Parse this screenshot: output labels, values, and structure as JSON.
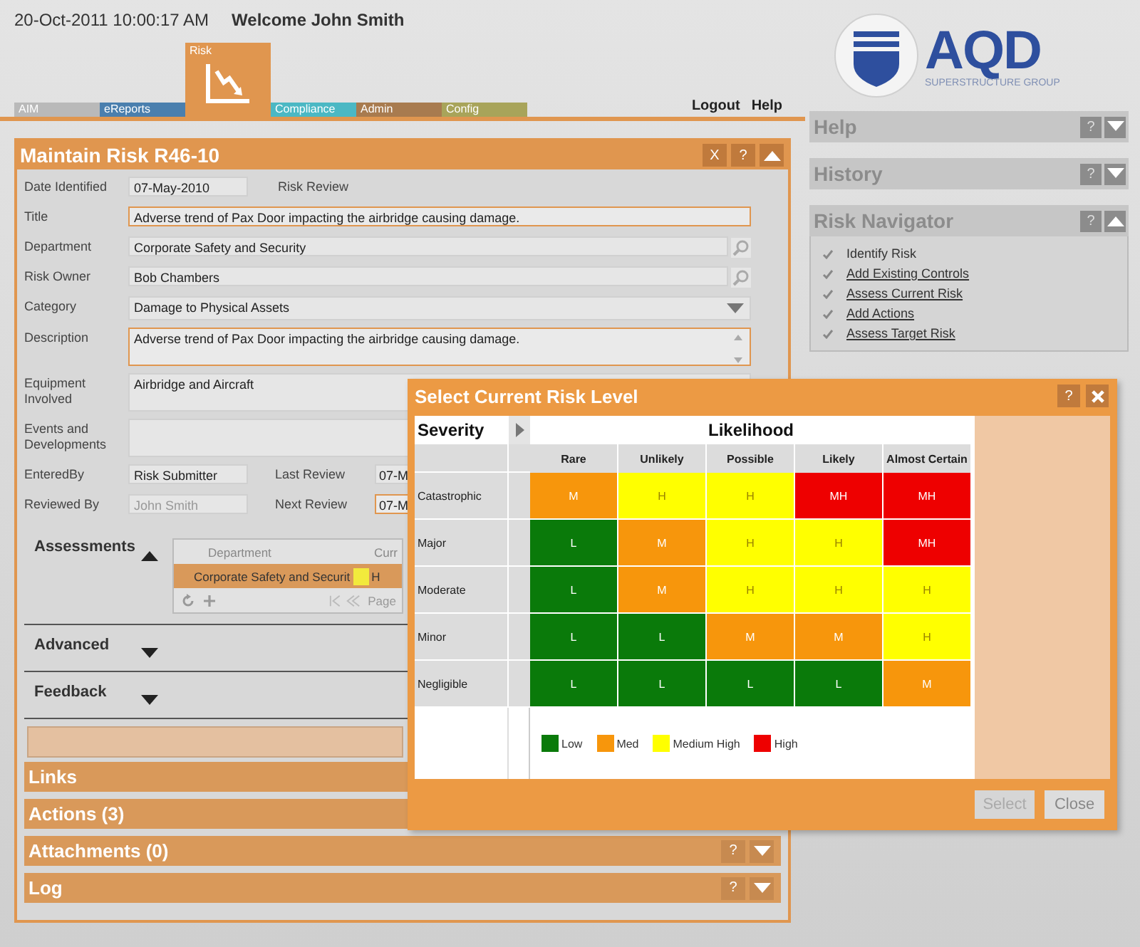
{
  "header": {
    "datetime": "20-Oct-2011 10:00:17 AM",
    "welcome": "Welcome John Smith",
    "links": [
      "Logout",
      "Help"
    ]
  },
  "nav_tabs": [
    {
      "label": "AIM",
      "selected": false,
      "color": "#b9b9b9"
    },
    {
      "label": "eReports",
      "selected": false,
      "color": "#4a7fae"
    },
    {
      "label": "Risk",
      "selected": true,
      "color": "#e0964f"
    },
    {
      "label": "Compliance",
      "selected": false,
      "color": "#4bb8c4"
    },
    {
      "label": "Admin",
      "selected": false,
      "color": "#a87b4f"
    },
    {
      "label": "Config",
      "selected": false,
      "color": "#a8a45a"
    }
  ],
  "logo": {
    "name": "AQD",
    "tagline": "SUPERSTRUCTURE GROUP"
  },
  "main_panel": {
    "title": "Maintain Risk R46-10",
    "close_button": "X",
    "help_button": "?",
    "expanded": true,
    "fields": [
      {
        "kind": "note",
        "label": "Date Identified",
        "value": "07-May-2010",
        "note": "Risk Review"
      },
      {
        "kind": "text",
        "label": "Title",
        "value": "Adverse trend of Pax Door impacting the airbridge causing damage.",
        "highlighted": true
      },
      {
        "kind": "lookup",
        "label": "Department",
        "value": "Corporate Safety and Security",
        "highlighted": false
      },
      {
        "kind": "lookup",
        "label": "Risk Owner",
        "value": "Bob Chambers",
        "highlighted": false
      },
      {
        "kind": "dropdown",
        "label": "Category",
        "value": "Damage to Physical Assets",
        "highlighted": false
      },
      {
        "kind": "textarea",
        "label": "Description",
        "value": "Adverse trend of Pax Door impacting the airbridge causing damage.",
        "highlighted": true
      },
      {
        "kind": "area",
        "label": "Equipment Involved",
        "value": "Airbridge and Aircraft",
        "highlighted": false
      },
      {
        "kind": "area",
        "label": "Events and Developments",
        "highlighted": false
      },
      {
        "kind": "pair",
        "label": "EnteredBy",
        "value": "Risk Submitter",
        "disabled": false,
        "second_label": "Last Review",
        "second_value": "07-M",
        "second_highlighted": false
      },
      {
        "kind": "pair",
        "label": "Reviewed By",
        "value": "John Smith",
        "disabled": true,
        "second_label": "Next Review",
        "second_value": "07-M",
        "second_highlighted": true
      }
    ],
    "assessments": {
      "label": "Assessments",
      "expanded": true,
      "columns": [
        "Department",
        "Curr"
      ],
      "rows": [
        {
          "department": "Corporate Safety and Securit",
          "color": "#f2ea3c",
          "level": "H",
          "selected": true
        }
      ],
      "pager": "Page"
    },
    "subsections": [
      {
        "label": "Advanced",
        "expanded": false
      },
      {
        "label": "Feedback",
        "expanded": false
      }
    ],
    "sections": [
      {
        "label": "Links"
      },
      {
        "label": "Actions (3)"
      },
      {
        "label": "Attachments (0)",
        "expanded": false,
        "help_button": "?"
      },
      {
        "label": "Log",
        "expanded": false,
        "help_button": "?"
      }
    ]
  },
  "sidebar": [
    {
      "title": "Help",
      "help_button": "?",
      "expanded": false
    },
    {
      "title": "History",
      "help_button": "?",
      "expanded": false
    },
    {
      "title": "Risk Navigator",
      "help_button": "?",
      "expanded": true,
      "items": [
        {
          "label": "Identify Risk",
          "link": false
        },
        {
          "label": "Add Existing Controls",
          "link": true
        },
        {
          "label": "Assess Current Risk",
          "link": true
        },
        {
          "label": "Add Actions",
          "link": true
        },
        {
          "label": "Assess Target Risk",
          "link": true
        }
      ]
    }
  ],
  "dialog": {
    "title": "Select Current Risk Level",
    "help_button": "?",
    "severity_header": "Severity",
    "likelihood_header": "Likelihood",
    "columns": [
      "Rare",
      "Unlikely",
      "Possible",
      "Likely",
      "Almost Certain"
    ],
    "rows": [
      {
        "severity": "Catastrophic",
        "cells": [
          {
            "text": "M",
            "color": "#f7960c"
          },
          {
            "text": "H",
            "color": "#ffff00"
          },
          {
            "text": "H",
            "color": "#ffff00"
          },
          {
            "text": "MH",
            "color": "#ee0000"
          },
          {
            "text": "MH",
            "color": "#ee0000"
          }
        ]
      },
      {
        "severity": "Major",
        "cells": [
          {
            "text": "L",
            "color": "#0a7a0a"
          },
          {
            "text": "M",
            "color": "#f7960c"
          },
          {
            "text": "H",
            "color": "#ffff00"
          },
          {
            "text": "H",
            "color": "#ffff00"
          },
          {
            "text": "MH",
            "color": "#ee0000"
          }
        ]
      },
      {
        "severity": "Moderate",
        "cells": [
          {
            "text": "L",
            "color": "#0a7a0a"
          },
          {
            "text": "M",
            "color": "#f7960c"
          },
          {
            "text": "H",
            "color": "#ffff00"
          },
          {
            "text": "H",
            "color": "#ffff00"
          },
          {
            "text": "H",
            "color": "#ffff00"
          }
        ]
      },
      {
        "severity": "Minor",
        "cells": [
          {
            "text": "L",
            "color": "#0a7a0a"
          },
          {
            "text": "L",
            "color": "#0a7a0a"
          },
          {
            "text": "M",
            "color": "#f7960c"
          },
          {
            "text": "M",
            "color": "#f7960c"
          },
          {
            "text": "H",
            "color": "#ffff00"
          }
        ]
      },
      {
        "severity": "Negligible",
        "cells": [
          {
            "text": "L",
            "color": "#0a7a0a"
          },
          {
            "text": "L",
            "color": "#0a7a0a"
          },
          {
            "text": "L",
            "color": "#0a7a0a"
          },
          {
            "text": "L",
            "color": "#0a7a0a"
          },
          {
            "text": "M",
            "color": "#f7960c"
          }
        ]
      }
    ],
    "legend": [
      {
        "label": "Low",
        "color": "#0a7a0a"
      },
      {
        "label": "Med",
        "color": "#f7960c"
      },
      {
        "label": "Medium High",
        "color": "#ffff00"
      },
      {
        "label": "High",
        "color": "#ee0000"
      }
    ],
    "buttons": [
      {
        "label": "Select",
        "disabled": true
      },
      {
        "label": "Close",
        "disabled": false
      }
    ]
  }
}
